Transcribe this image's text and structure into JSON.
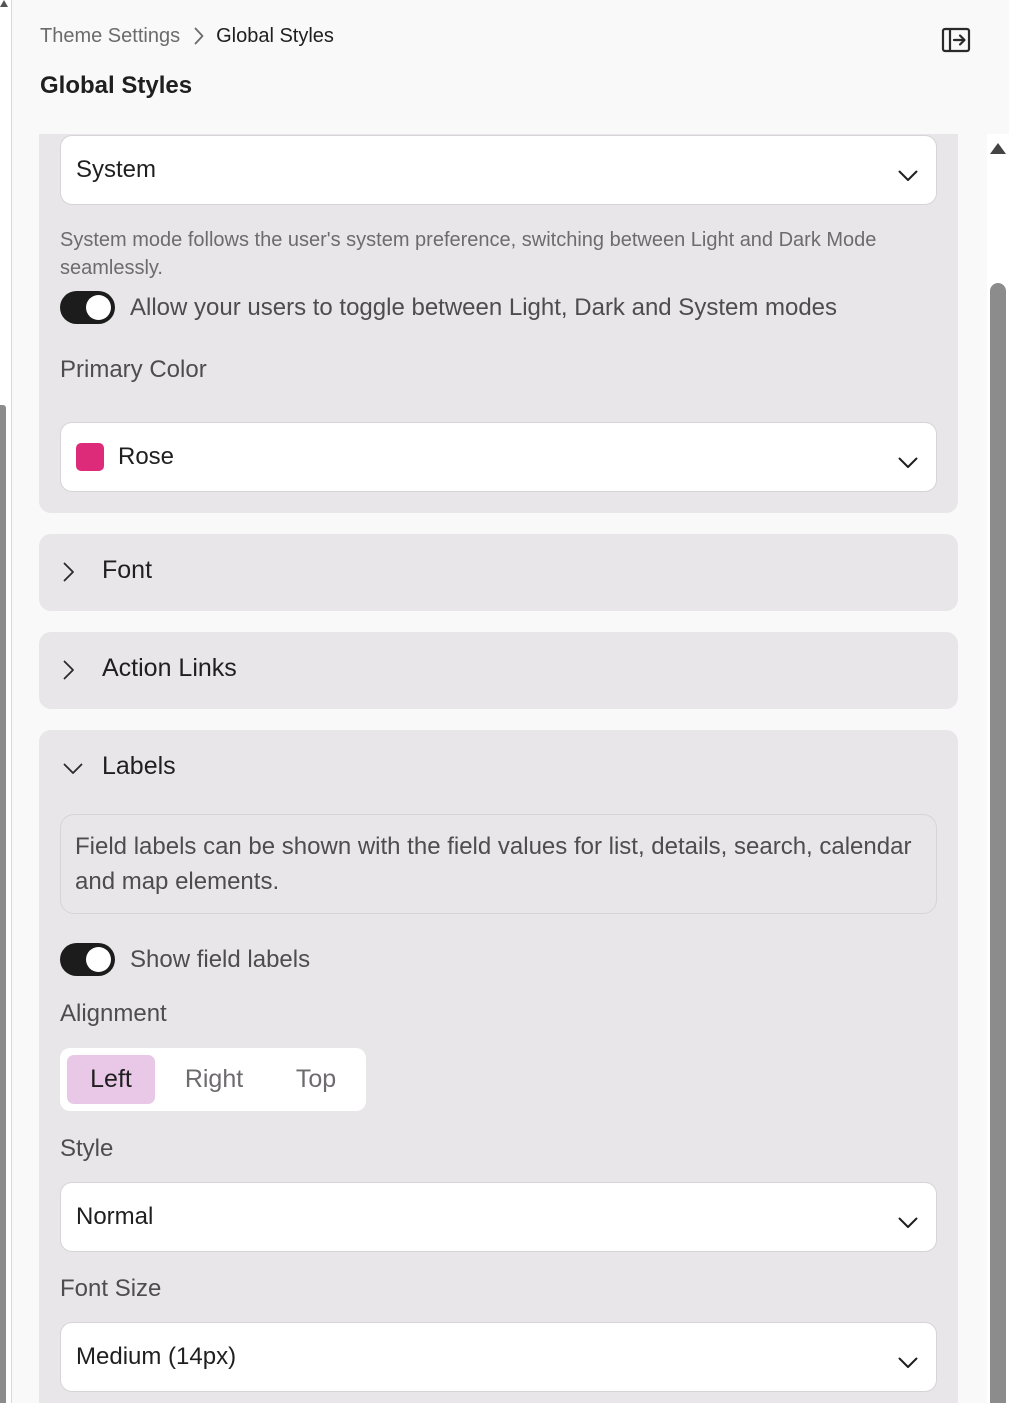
{
  "breadcrumb": {
    "parent": "Theme Settings",
    "current": "Global Styles"
  },
  "page_title": "Global Styles",
  "icons": {
    "chevron": "chevron-right-icon",
    "collapse": "collapse-panel-icon",
    "select_chevron": "chevron-down-icon"
  },
  "appearance": {
    "mode_value": "System",
    "mode_help": "System mode follows the user's system preference, switching between Light and Dark Mode seamlessly.",
    "toggle_label": "Allow your users to toggle between Light, Dark and System modes",
    "toggle_on": true,
    "primary_color_label": "Primary Color",
    "primary_color_value": "Rose",
    "primary_color_hex": "#de2b79"
  },
  "sections": {
    "font": "Font",
    "action_links": "Action Links",
    "labels": "Labels"
  },
  "labels_section": {
    "info": "Field labels can be shown with the field values for list, details, search, calendar and map elements.",
    "show_labels_toggle": "Show field labels",
    "show_labels_on": true,
    "alignment_label": "Alignment",
    "alignment_options": [
      "Left",
      "Right",
      "Top"
    ],
    "alignment_selected": "Left",
    "style_label": "Style",
    "style_value": "Normal",
    "font_size_label": "Font Size",
    "font_size_value": "Medium (14px)"
  },
  "colors": {
    "panel_bg": "#e8e6e8",
    "toggle_on": "#1c1c1c",
    "segment_active": "#e8c8e6"
  }
}
